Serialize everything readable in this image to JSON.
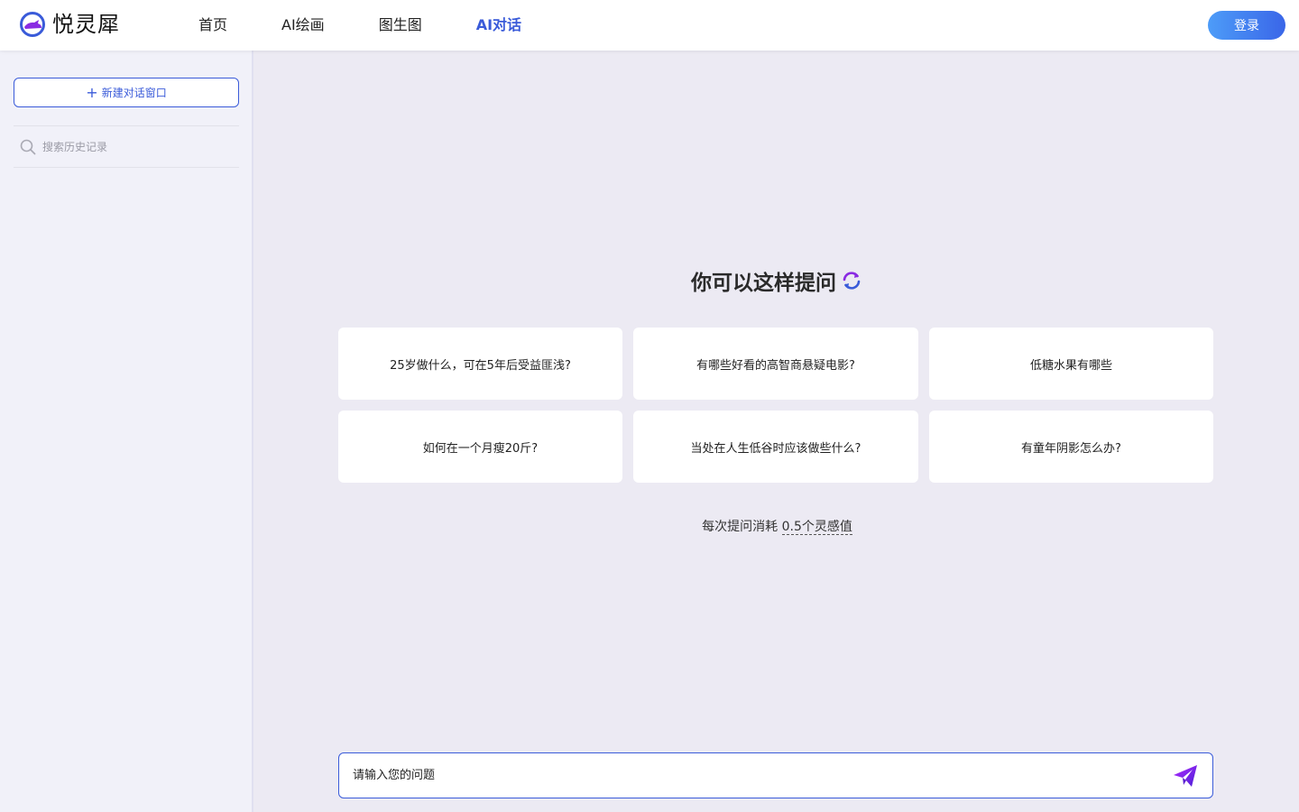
{
  "header": {
    "logo_text": "悦灵犀",
    "nav": [
      {
        "label": "首页",
        "active": false
      },
      {
        "label": "AI绘画",
        "active": false
      },
      {
        "label": "图生图",
        "active": false
      },
      {
        "label": "AI对话",
        "active": true
      }
    ],
    "login_label": "登录"
  },
  "sidebar": {
    "new_chat_label": "新建对话窗口",
    "search_placeholder": "搜索历史记录"
  },
  "main": {
    "prompt_title": "你可以这样提问",
    "suggestions": [
      "25岁做什么，可在5年后受益匪浅?",
      "有哪些好看的高智商悬疑电影?",
      "低糖水果有哪些",
      "如何在一个月瘦20斤?",
      "当处在人生低谷时应该做些什么?",
      "有童年阴影怎么办?"
    ],
    "cost_prefix": "每次提问消耗",
    "cost_amount": "0.5个灵感值",
    "input_placeholder": "请输入您的问题"
  },
  "colors": {
    "accent": "#3a5bd9",
    "brand_purple": "#8a2be2",
    "background": "#eceaf3",
    "sidebar_bg": "#f1f1f9"
  },
  "icons": {
    "logo": "rhino-logo-icon",
    "plus": "plus-icon",
    "search": "search-icon",
    "refresh": "refresh-icon",
    "send": "paper-plane-icon"
  }
}
